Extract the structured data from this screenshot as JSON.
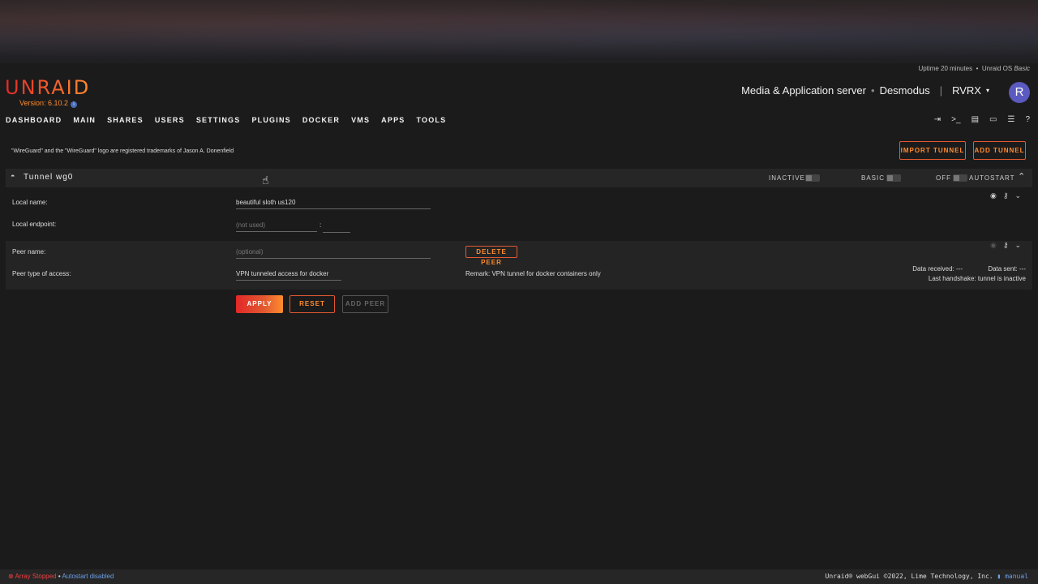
{
  "header": {
    "logo": "UNRAID",
    "version": "Version: 6.10.2",
    "uptime": "Uptime 20 minutes",
    "os_label": "Unraid OS",
    "os_edition": "Basic",
    "server_description": "Media & Application server",
    "server_name": "Desmodus",
    "user": "RVRX",
    "avatar_letter": "R"
  },
  "nav": {
    "items": [
      "DASHBOARD",
      "MAIN",
      "SHARES",
      "USERS",
      "SETTINGS",
      "PLUGINS",
      "DOCKER",
      "VMS",
      "APPS",
      "TOOLS"
    ],
    "icons": [
      "logout-icon",
      "terminal-icon",
      "feedback-icon",
      "screen-icon",
      "log-icon",
      "help-icon"
    ]
  },
  "content": {
    "trademark": "\"WireGuard\" and the \"WireGuard\" logo are registered trademarks of Jason A. Donenfield",
    "import_tunnel": "IMPORT TUNNEL",
    "add_tunnel": "ADD TUNNEL",
    "tunnel": {
      "title": "Tunnel wg0",
      "status_label": "INACTIVE",
      "mode_label": "BASIC",
      "autostart_off": "OFF",
      "autostart_label": "AUTOSTART"
    },
    "local_name_label": "Local name:",
    "local_name_value": "beautiful sloth us120",
    "local_endpoint_label": "Local endpoint:",
    "local_endpoint_placeholder": "(not used)",
    "endpoint_sep": ":",
    "peer": {
      "name_label": "Peer name:",
      "name_placeholder": "(optional)",
      "delete_peer": "DELETE PEER",
      "access_label": "Peer type of access:",
      "access_value": "VPN tunneled access for docker",
      "remark": "Remark: VPN tunnel for docker containers only",
      "data_received": "Data received: ---",
      "data_sent": "Data sent: ---",
      "last_handshake": "Last handshake: tunnel is inactive"
    },
    "apply": "APPLY",
    "reset": "RESET",
    "add_peer": "ADD PEER"
  },
  "statusbar": {
    "array_status": "Array Stopped",
    "bullet": "•",
    "autostart": "Autostart disabled",
    "copyright": "Unraid® webGui ©2022, Lime Technology, Inc.",
    "manual": "manual"
  }
}
